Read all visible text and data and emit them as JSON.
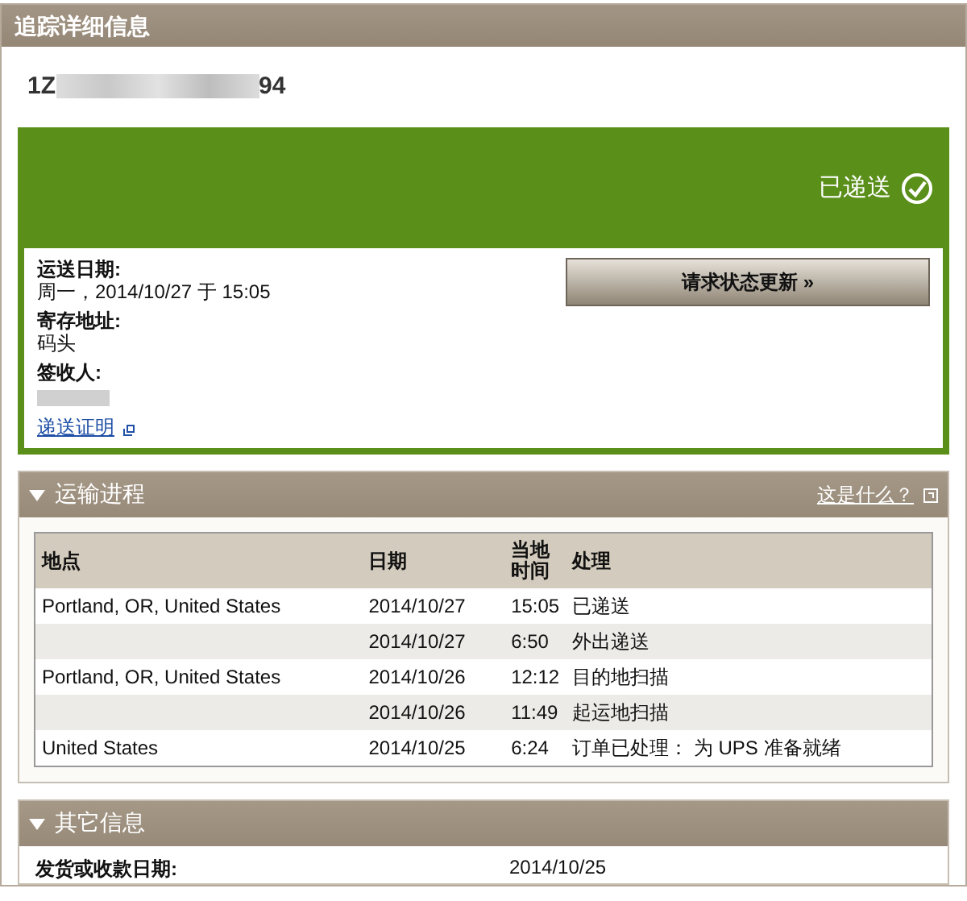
{
  "title": "追踪详细信息",
  "tracking": {
    "prefix": "1Z",
    "suffix": "94"
  },
  "status": {
    "label": "已递送",
    "delivered": true
  },
  "details": [
    {
      "label": "运送日期:",
      "value": "周一，2014/10/27 于 15:05"
    },
    {
      "label": "寄存地址:",
      "value": "码头"
    },
    {
      "label": "签收人:"
    }
  ],
  "proof_link": "递送证明",
  "update_button": "请求状态更新 »",
  "progress": {
    "title": "运输进程",
    "expanded": true,
    "help_link": "这是什么？",
    "columns": [
      "地点",
      "日期",
      "当地时间",
      "处理"
    ],
    "rows": [
      [
        "Portland, OR, United States",
        "2014/10/27",
        "15:05",
        "已递送"
      ],
      [
        "",
        "2014/10/27",
        "6:50",
        "外出递送"
      ],
      [
        "Portland, OR, United States",
        "2014/10/26",
        "12:12",
        "目的地扫描"
      ],
      [
        "",
        "2014/10/26",
        "11:49",
        "起运地扫描"
      ],
      [
        "United States",
        "2014/10/25",
        "6:24",
        "订单已处理： 为 UPS 准备就绪"
      ]
    ]
  },
  "other": {
    "title": "其它信息",
    "expanded": true,
    "rows": [
      {
        "label": "发货或收款日期:",
        "value": "2014/10/25"
      }
    ]
  }
}
